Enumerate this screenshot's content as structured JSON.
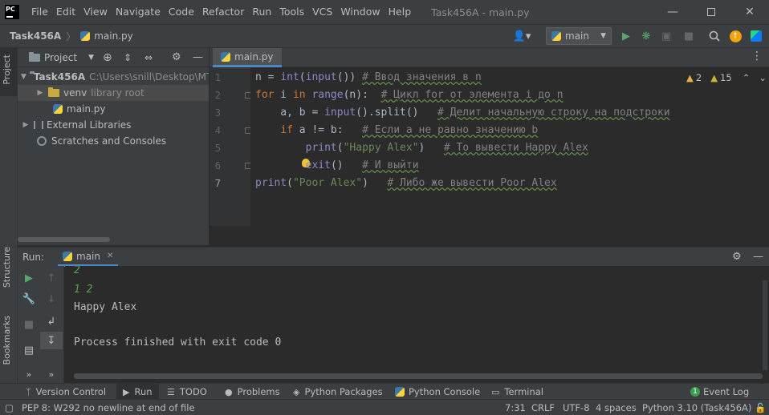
{
  "app": {
    "logo_text": "PC",
    "window_title": "Task456A - main.py"
  },
  "menu": [
    "File",
    "Edit",
    "View",
    "Navigate",
    "Code",
    "Refactor",
    "Run",
    "Tools",
    "VCS",
    "Window",
    "Help"
  ],
  "navbar": {
    "project": "Task456A",
    "separator": "〉",
    "file": "main.py",
    "run_config": "main"
  },
  "left_strip": {
    "project_tab": "Project",
    "structure_tab": "Structure",
    "bookmarks_tab": "Bookmarks"
  },
  "project_panel": {
    "title": "Project",
    "tree": [
      {
        "label": "Task456A",
        "hint": "C:\\Users\\snill\\Desktop\\MT"
      },
      {
        "label": "venv",
        "hint": "library root"
      },
      {
        "label": "main.py",
        "hint": ""
      },
      {
        "label": "External Libraries",
        "hint": ""
      },
      {
        "label": "Scratches and Consoles",
        "hint": ""
      }
    ]
  },
  "editor": {
    "tab": "main.py",
    "warnings": "2",
    "weak_warnings": "15",
    "line_numbers": [
      "1",
      "2",
      "3",
      "4",
      "5",
      "6",
      "7"
    ],
    "lines": [
      [
        [
          "n = ",
          "plain"
        ],
        [
          "int",
          "bi"
        ],
        [
          "(",
          "plain"
        ],
        [
          "input",
          "bi"
        ],
        [
          "()) ",
          "plain"
        ],
        [
          "# Ввод значения в n",
          "com"
        ]
      ],
      [
        [
          "for",
          "kw"
        ],
        [
          " i ",
          "plain"
        ],
        [
          "in",
          "kw"
        ],
        [
          " ",
          "plain"
        ],
        [
          "range",
          "bi"
        ],
        [
          "(n):  ",
          "plain"
        ],
        [
          "# Цикл for от элемента i до n",
          "com"
        ]
      ],
      [
        [
          "    a, b = ",
          "plain"
        ],
        [
          "input",
          "bi"
        ],
        [
          "().split()   ",
          "plain"
        ],
        [
          "# Делит начальную строку на подстроки",
          "com"
        ]
      ],
      [
        [
          "    ",
          "plain"
        ],
        [
          "if",
          "kw"
        ],
        [
          " a != b:   ",
          "plain"
        ],
        [
          "# Если a не равно значению b",
          "com"
        ]
      ],
      [
        [
          "        ",
          "plain"
        ],
        [
          "print",
          "bi"
        ],
        [
          "(",
          "plain"
        ],
        [
          "\"Happy Alex\"",
          "str"
        ],
        [
          ")   ",
          "plain"
        ],
        [
          "# То вывести Happy Alex",
          "com"
        ]
      ],
      [
        [
          "        ",
          "plain"
        ],
        [
          "exit",
          "bi"
        ],
        [
          "()   ",
          "plain"
        ],
        [
          "# И выйти",
          "com"
        ]
      ],
      [
        [
          "print",
          "bi"
        ],
        [
          "(",
          "plain"
        ],
        [
          "\"Poor Alex\"",
          "str"
        ],
        [
          ")   ",
          "plain"
        ],
        [
          "# Либо же вывести Poor Alex",
          "com"
        ]
      ]
    ]
  },
  "run_panel": {
    "label": "Run:",
    "tab": "main",
    "output": [
      {
        "text": "2",
        "color": "#52a352"
      },
      {
        "text": "1 2",
        "color": "#52a352"
      },
      {
        "text": "Happy Alex",
        "color": "#bbbbbb"
      },
      {
        "text": "",
        "color": "#bbbbbb"
      },
      {
        "text": "Process finished with exit code 0",
        "color": "#bbbbbb"
      }
    ]
  },
  "bottom_tabs": {
    "version_control": "Version Control",
    "run": "Run",
    "todo": "TODO",
    "problems": "Problems",
    "python_packages": "Python Packages",
    "python_console": "Python Console",
    "terminal": "Terminal",
    "event_log_count": "1",
    "event_log": "Event Log"
  },
  "statusbar": {
    "message": "PEP 8: W292 no newline at end of file",
    "position": "7:31",
    "line_sep": "CRLF",
    "encoding": "UTF-8",
    "indent": "4 spaces",
    "interpreter": "Python 3.10 (Task456A)"
  },
  "colors": {
    "accent": "#4a88c7",
    "run_green": "#59a869",
    "output_green": "#52a352"
  }
}
